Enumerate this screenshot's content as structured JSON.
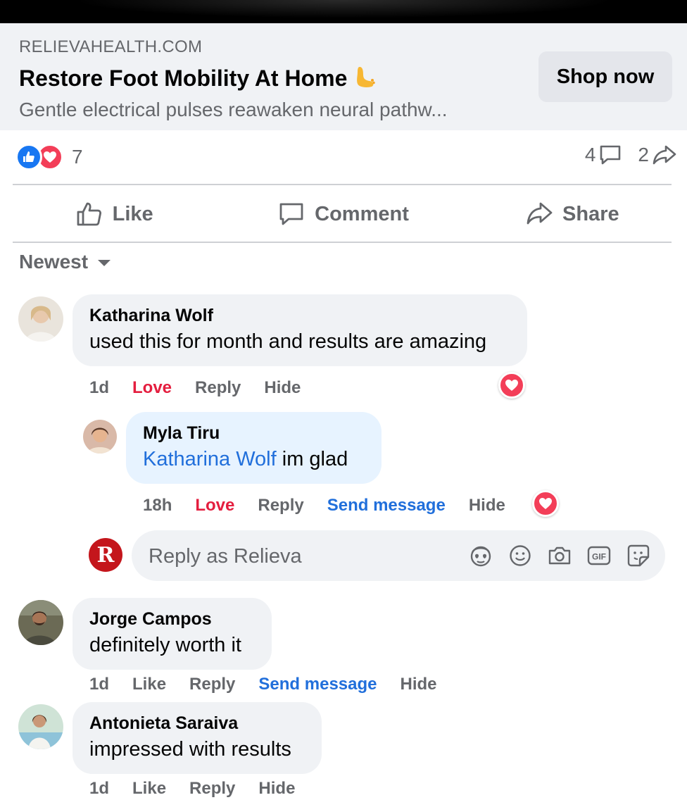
{
  "ad": {
    "domain": "RELIEVAHEALTH.COM",
    "title": "Restore Foot Mobility At Home",
    "title_emoji": "foot-emoji",
    "description": "Gentle electrical pulses reawaken neural pathw...",
    "cta_label": "Shop now"
  },
  "stats": {
    "reaction_count": "7",
    "comment_count": "4",
    "share_count": "2"
  },
  "actions": {
    "like_label": "Like",
    "comment_label": "Comment",
    "share_label": "Share"
  },
  "sort_label": "Newest",
  "comments": [
    {
      "author": "Katharina Wolf",
      "text": "used this for month and results are amazing",
      "time": "1d",
      "reaction_label": "Love",
      "reply_label": "Reply",
      "hide_label": "Hide",
      "replies": [
        {
          "author": "Myla Tiru",
          "mention": "Katharina Wolf",
          "text": " im glad",
          "time": "18h",
          "reaction_label": "Love",
          "reply_label": "Reply",
          "send_message_label": "Send message",
          "hide_label": "Hide"
        }
      ]
    },
    {
      "author": "Jorge Campos",
      "text": "definitely worth it",
      "time": "1d",
      "reaction_label": "Like",
      "reply_label": "Reply",
      "send_message_label": "Send message",
      "hide_label": "Hide"
    },
    {
      "author": "Antonieta Saraiva",
      "text": "impressed with results",
      "time": "1d",
      "reaction_label": "Like",
      "reply_label": "Reply",
      "hide_label": "Hide"
    }
  ],
  "reply_box": {
    "placeholder": "Reply as Relieva",
    "page_avatar_letter": "R",
    "icons": [
      "avatar-sticker-icon",
      "emoji-icon",
      "camera-icon",
      "gif-icon",
      "sticker-icon"
    ]
  },
  "colors": {
    "like_blue": "#1877f2",
    "love_red": "#f33e58",
    "love_text": "#e41e3f",
    "link_blue": "#216fdb",
    "bubble_gray": "#f0f2f5",
    "bubble_highlight": "#e7f3ff",
    "secondary_text": "#65676b"
  }
}
